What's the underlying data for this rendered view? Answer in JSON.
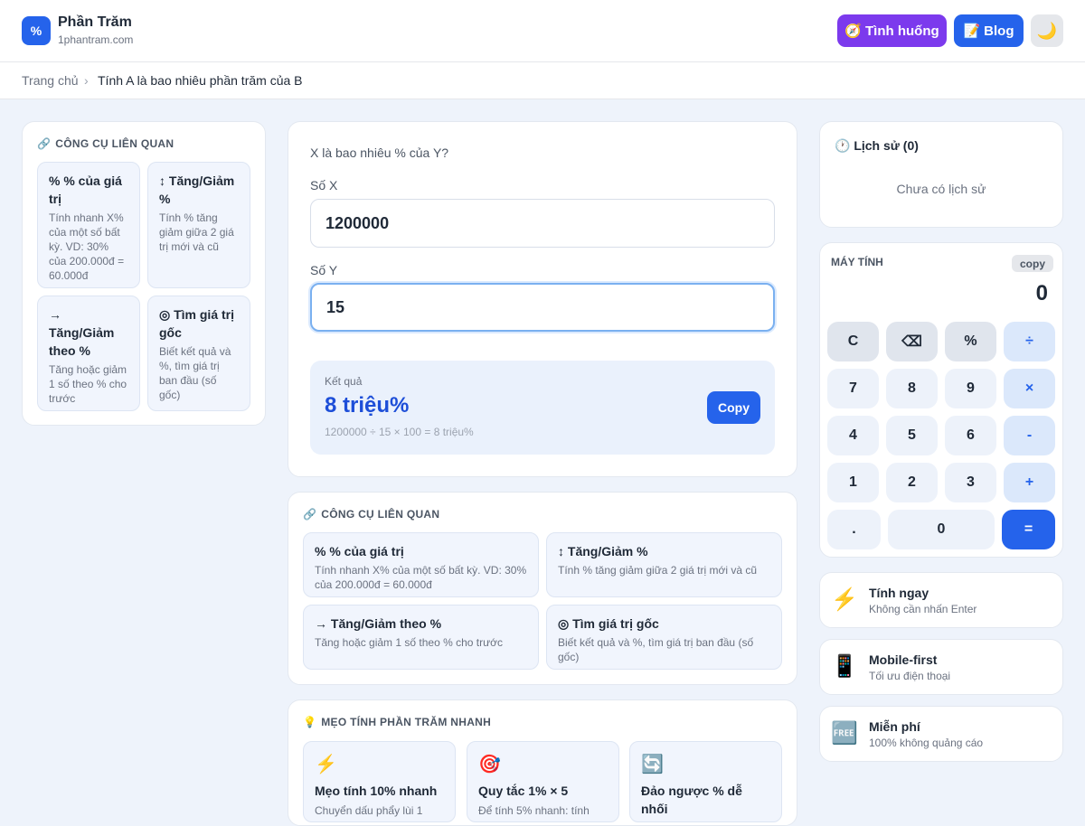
{
  "header": {
    "logo_symbol": "%",
    "brand_name": "Phần Trăm",
    "brand_domain": "1phantram.com",
    "situation_icon": "🧭",
    "situation_label": "Tình huống",
    "blog_icon": "📝",
    "blog_label": "Blog",
    "theme_icon": "🌙"
  },
  "breadcrumb": {
    "home": "Trang chủ",
    "separator": "›",
    "current": "Tính A là bao nhiêu phần trăm của B"
  },
  "related_left": {
    "icon": "🔗",
    "title": "CÔNG CỤ LIÊN QUAN",
    "items": [
      {
        "title": "% % của giá trị",
        "desc": "Tính nhanh X% của một số bất kỳ. VD: 30% của 200.000đ = 60.000đ"
      },
      {
        "title": "↕ Tăng/Giảm %",
        "desc": "Tính % tăng giảm giữa 2 giá trị mới và cũ"
      },
      {
        "title": "→ Tăng/Giảm theo %",
        "desc": "Tăng hoặc giảm 1 số theo % cho trước"
      },
      {
        "title": "◎ Tìm giá trị gốc",
        "desc": "Biết kết quả và %, tìm giá trị ban đầu (số gốc)"
      }
    ]
  },
  "calculator": {
    "question": "X là bao nhiêu % của Y?",
    "x_label": "Số X",
    "x_value": "1200000",
    "y_label": "Số Y",
    "y_value": "15",
    "result_label": "Kết quả",
    "result_value": "8 triệu%",
    "result_formula": "1200000 ÷ 15 × 100 = 8 triệu%",
    "copy_label": "Copy"
  },
  "related_center": {
    "icon": "🔗",
    "title": "CÔNG CỤ LIÊN QUAN",
    "items": [
      {
        "title": "% % của giá trị",
        "desc": "Tính nhanh X% của một số bất kỳ. VD: 30% của 200.000đ = 60.000đ"
      },
      {
        "title": "↕ Tăng/Giảm %",
        "desc": "Tính % tăng giảm giữa 2 giá trị mới và cũ"
      },
      {
        "title": "→ Tăng/Giảm theo %",
        "desc": "Tăng hoặc giảm 1 số theo % cho trước"
      },
      {
        "title": "◎ Tìm giá trị gốc",
        "desc": "Biết kết quả và %, tìm giá trị ban đầu (số gốc)"
      }
    ]
  },
  "tips": {
    "icon": "💡",
    "title": "MẸO TÍNH PHẦN TRĂM NHANH",
    "items": [
      {
        "icon": "⚡",
        "title": "Mẹo tính 10% nhanh",
        "desc": "Chuyển dấu phẩy lùi 1"
      },
      {
        "icon": "🎯",
        "title": "Quy tắc 1% × 5",
        "desc": "Để tính 5% nhanh: tính"
      },
      {
        "icon": "🔄",
        "title": "Đảo ngược % dễ nhối",
        "desc": ""
      }
    ]
  },
  "history": {
    "icon": "🕐",
    "title": "Lịch sử (0)",
    "empty_text": "Chưa có lịch sử"
  },
  "mini_calc": {
    "title": "MÁY TÍNH",
    "copy_label": "copy",
    "display": "0",
    "keys": [
      "C",
      "⌫",
      "%",
      "÷",
      "7",
      "8",
      "9",
      "×",
      "4",
      "5",
      "6",
      "-",
      "1",
      "2",
      "3",
      "+",
      ".",
      "0",
      "="
    ]
  },
  "features": [
    {
      "icon": "⚡",
      "title": "Tính ngay",
      "subtitle": "Không cần nhấn Enter"
    },
    {
      "icon": "📱",
      "title": "Mobile-first",
      "subtitle": "Tối ưu điện thoại"
    },
    {
      "icon": "🆓",
      "title": "Miễn phí",
      "subtitle": "100% không quảng cáo"
    }
  ]
}
